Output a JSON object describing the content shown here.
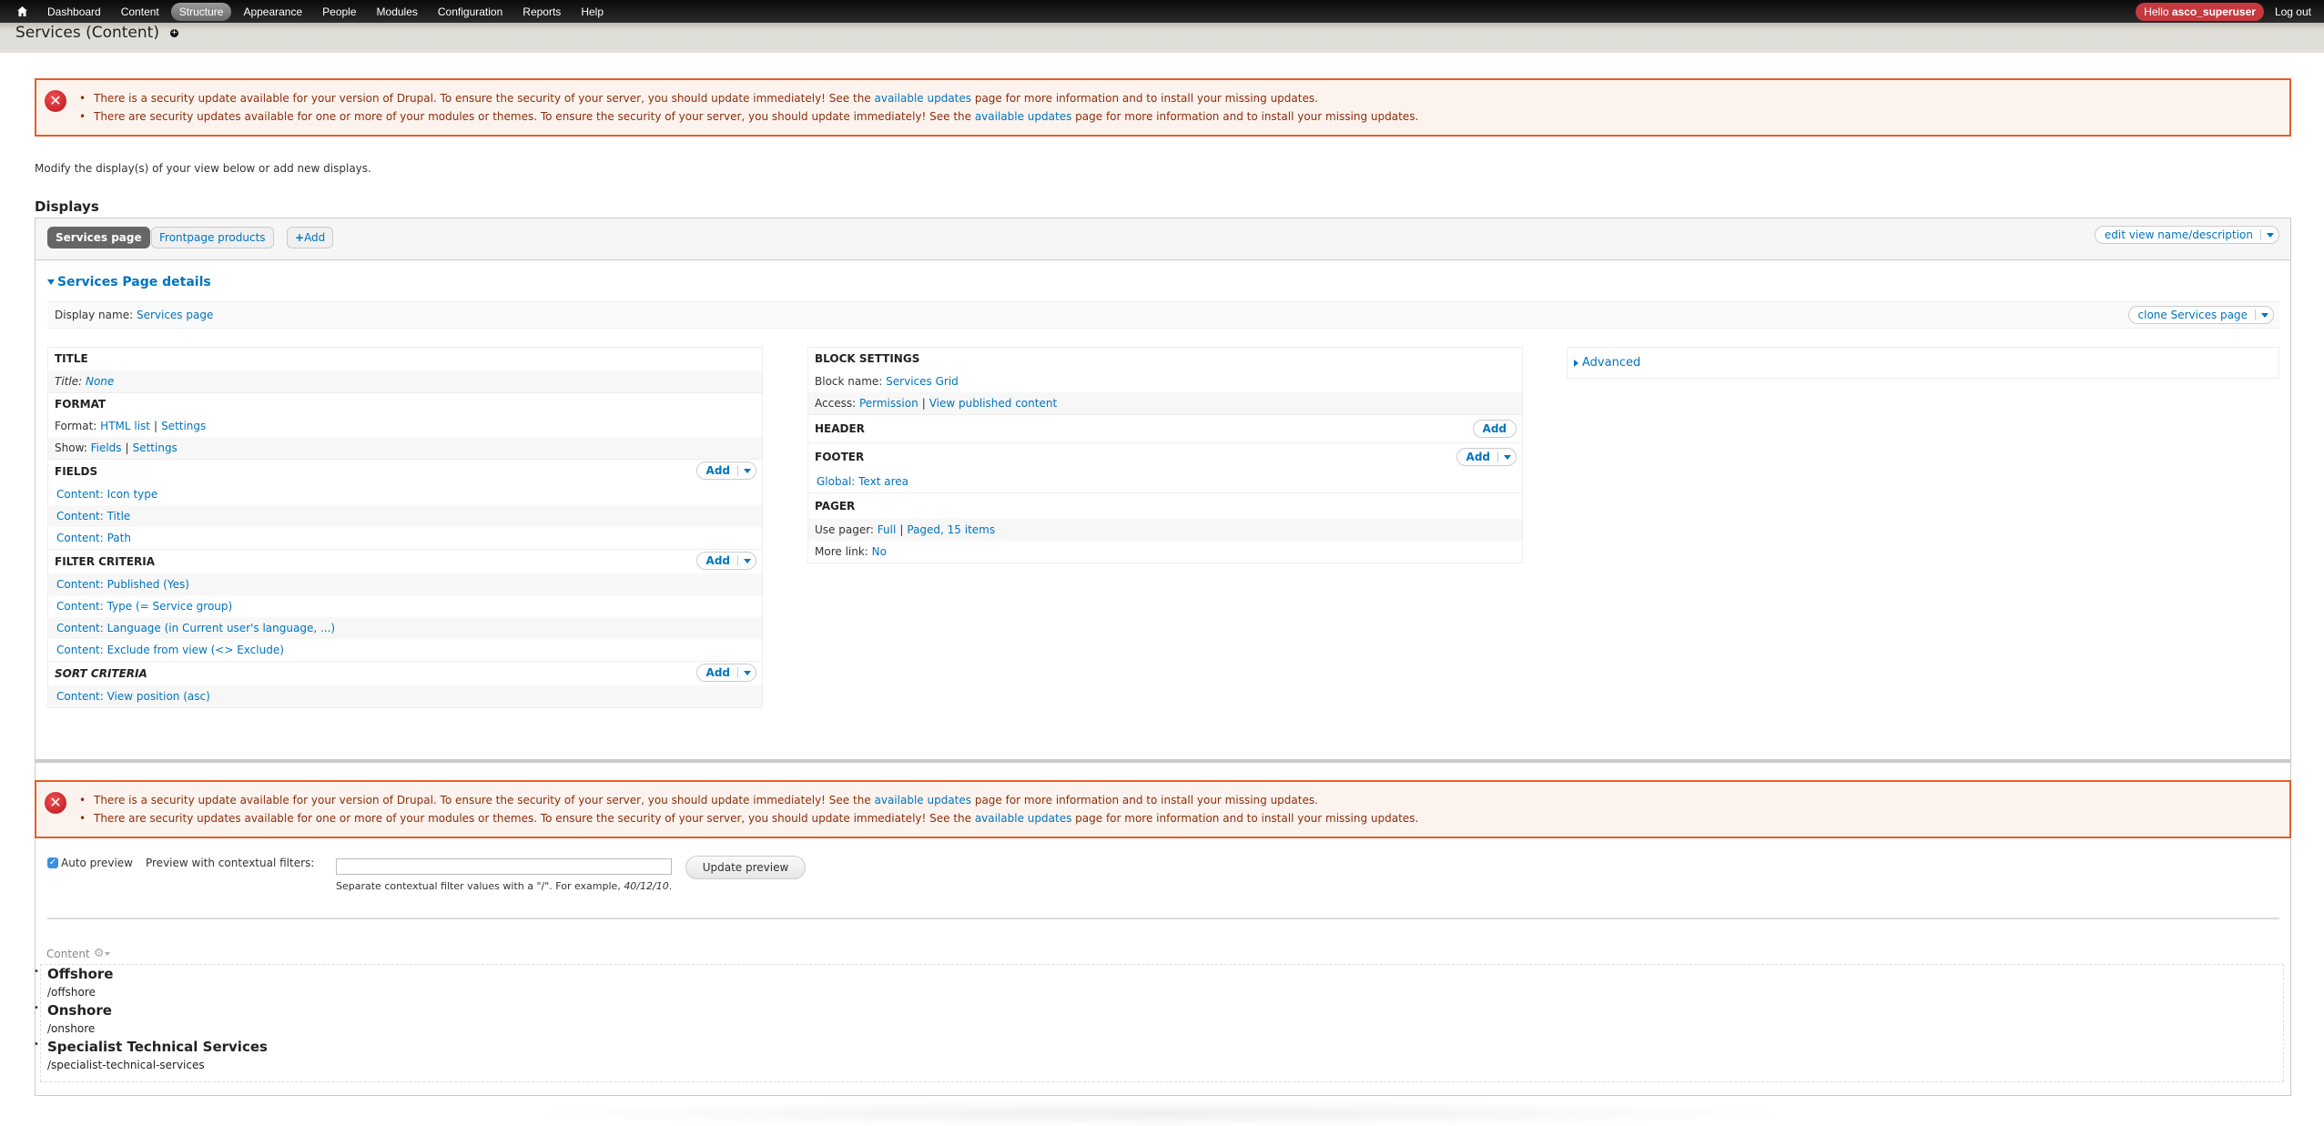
{
  "toolbar": {
    "home_icon": "home-icon",
    "items": [
      {
        "label": "Dashboard",
        "active": false
      },
      {
        "label": "Content",
        "active": false
      },
      {
        "label": "Structure",
        "active": true
      },
      {
        "label": "Appearance",
        "active": false
      },
      {
        "label": "People",
        "active": false
      },
      {
        "label": "Modules",
        "active": false
      },
      {
        "label": "Configuration",
        "active": false
      },
      {
        "label": "Reports",
        "active": false
      },
      {
        "label": "Help",
        "active": false
      }
    ],
    "hello_prefix": "Hello",
    "username": "asco_superuser",
    "logout": "Log out",
    "accent_color": "#c6393f"
  },
  "page": {
    "title": "Services (Content)",
    "add_shortcut_icon": "plus-circle-icon"
  },
  "messages": {
    "type": "error",
    "icon": "error-icon",
    "items": [
      {
        "before": "There is a security update available for your version of Drupal. To ensure the security of your server, you should update immediately! See the ",
        "link": "available updates",
        "after": " page for more information and to install your missing updates."
      },
      {
        "before": "There are security updates available for one or more of your modules or themes. To ensure the security of your server, you should update immediately! See the ",
        "link": "available updates",
        "after": " page for more information and to install your missing updates."
      }
    ],
    "border_color": "#e0602a",
    "bg_color": "#fdf3ee"
  },
  "intro": "Modify the display(s) of your view below or add new displays.",
  "displays": {
    "heading": "Displays",
    "tabs": [
      {
        "label": "Services page",
        "active": true
      },
      {
        "label": "Frontpage products",
        "active": false
      }
    ],
    "add_label": "Add",
    "edit_view_label": "edit view name/description",
    "details_heading": "Services Page details",
    "display_name_label": "Display name:",
    "display_name_value": "Services page",
    "clone_label": "clone Services page",
    "advanced_label": "Advanced",
    "left": {
      "title_h": "TITLE",
      "title_label": "Title:",
      "title_value": "None",
      "format_h": "FORMAT",
      "format_label": "Format:",
      "format_value": "HTML list",
      "format_settings": "Settings",
      "show_label": "Show:",
      "show_value": "Fields",
      "show_settings": "Settings",
      "fields_h": "FIELDS",
      "fields": [
        "Content: Icon type",
        "Content: Title",
        "Content: Path"
      ],
      "filter_h": "FILTER CRITERIA",
      "filters": [
        "Content: Published (Yes)",
        "Content: Type (= Service group)",
        "Content: Language (in Current user's language, ...)",
        "Content: Exclude from view (<> Exclude)"
      ],
      "sort_h": "SORT CRITERIA",
      "sorts": [
        "Content: View position (asc)"
      ],
      "add_label": "Add"
    },
    "middle": {
      "block_h": "BLOCK SETTINGS",
      "block_name_label": "Block name:",
      "block_name_value": "Services Grid",
      "access_label": "Access:",
      "access_value": "Permission",
      "access_detail": "View published content",
      "header_h": "HEADER",
      "footer_h": "FOOTER",
      "footer_items": [
        "Global: Text area"
      ],
      "pager_h": "PAGER",
      "use_pager_label": "Use pager:",
      "use_pager_value": "Full",
      "pager_detail": "Paged, 15 items",
      "more_link_label": "More link:",
      "more_link_value": "No",
      "add_label": "Add"
    }
  },
  "preview": {
    "auto_preview_label": "Auto preview",
    "auto_preview_checked": true,
    "contextual_label": "Preview with contextual filters:",
    "contextual_value": "",
    "update_button": "Update preview",
    "help_prefix": "Separate contextual filter values with a \"/\". For example, ",
    "help_example": "40/12/10",
    "help_suffix": ".",
    "content_label": "Content",
    "results": [
      {
        "title": "Offshore",
        "path": "/offshore"
      },
      {
        "title": "Onshore",
        "path": "/onshore"
      },
      {
        "title": "Specialist Technical Services",
        "path": "/specialist-technical-services"
      }
    ]
  }
}
